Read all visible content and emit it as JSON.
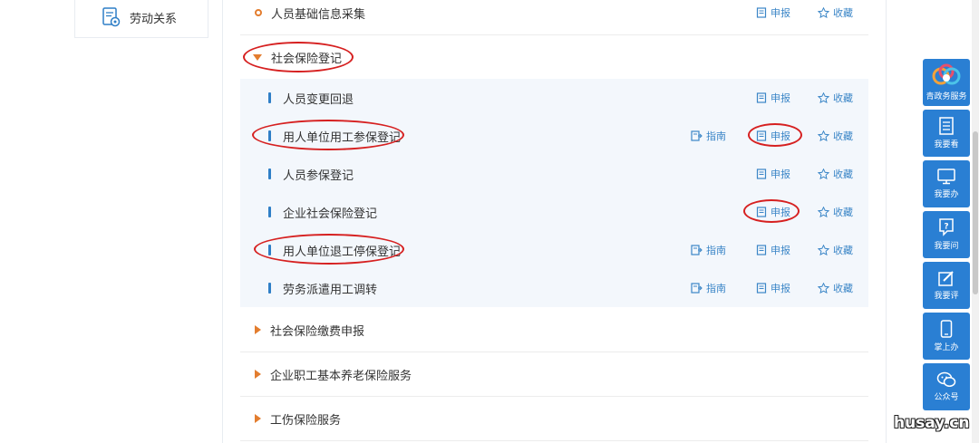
{
  "left_menu": {
    "item_label": "劳动关系"
  },
  "actions": {
    "guide": "指南",
    "report": "申报",
    "favorite": "收藏"
  },
  "sections": [
    {
      "title": "人员基础信息采集",
      "state": "item"
    },
    {
      "title": "社会保险登记",
      "state": "expanded"
    }
  ],
  "sub_items": [
    {
      "title": "人员变更回退",
      "has_guide": false
    },
    {
      "title": "用人单位用工参保登记",
      "has_guide": true
    },
    {
      "title": "人员参保登记",
      "has_guide": false
    },
    {
      "title": "企业社会保险登记",
      "has_guide": false
    },
    {
      "title": "用人单位退工停保登记",
      "has_guide": true
    },
    {
      "title": "劳务派遣用工调转",
      "has_guide": true
    }
  ],
  "collapsed_sections": [
    {
      "title": "社会保险缴费申报"
    },
    {
      "title": "企业职工基本养老保险服务"
    },
    {
      "title": "工伤保险服务"
    }
  ],
  "sidebar": [
    {
      "label": "青政务服务",
      "icon": "logo-icon"
    },
    {
      "label": "我要看",
      "icon": "document-icon"
    },
    {
      "label": "我要办",
      "icon": "monitor-icon"
    },
    {
      "label": "我要问",
      "icon": "question-icon"
    },
    {
      "label": "我要评",
      "icon": "edit-icon"
    },
    {
      "label": "掌上办",
      "icon": "phone-icon"
    },
    {
      "label": "公众号",
      "icon": "wechat-icon"
    }
  ],
  "watermark": "husay.cn",
  "colors": {
    "accent": "#2a7fd3",
    "link": "#3b86c7",
    "bullet": "#e37d2f",
    "annotation": "#d62020"
  }
}
